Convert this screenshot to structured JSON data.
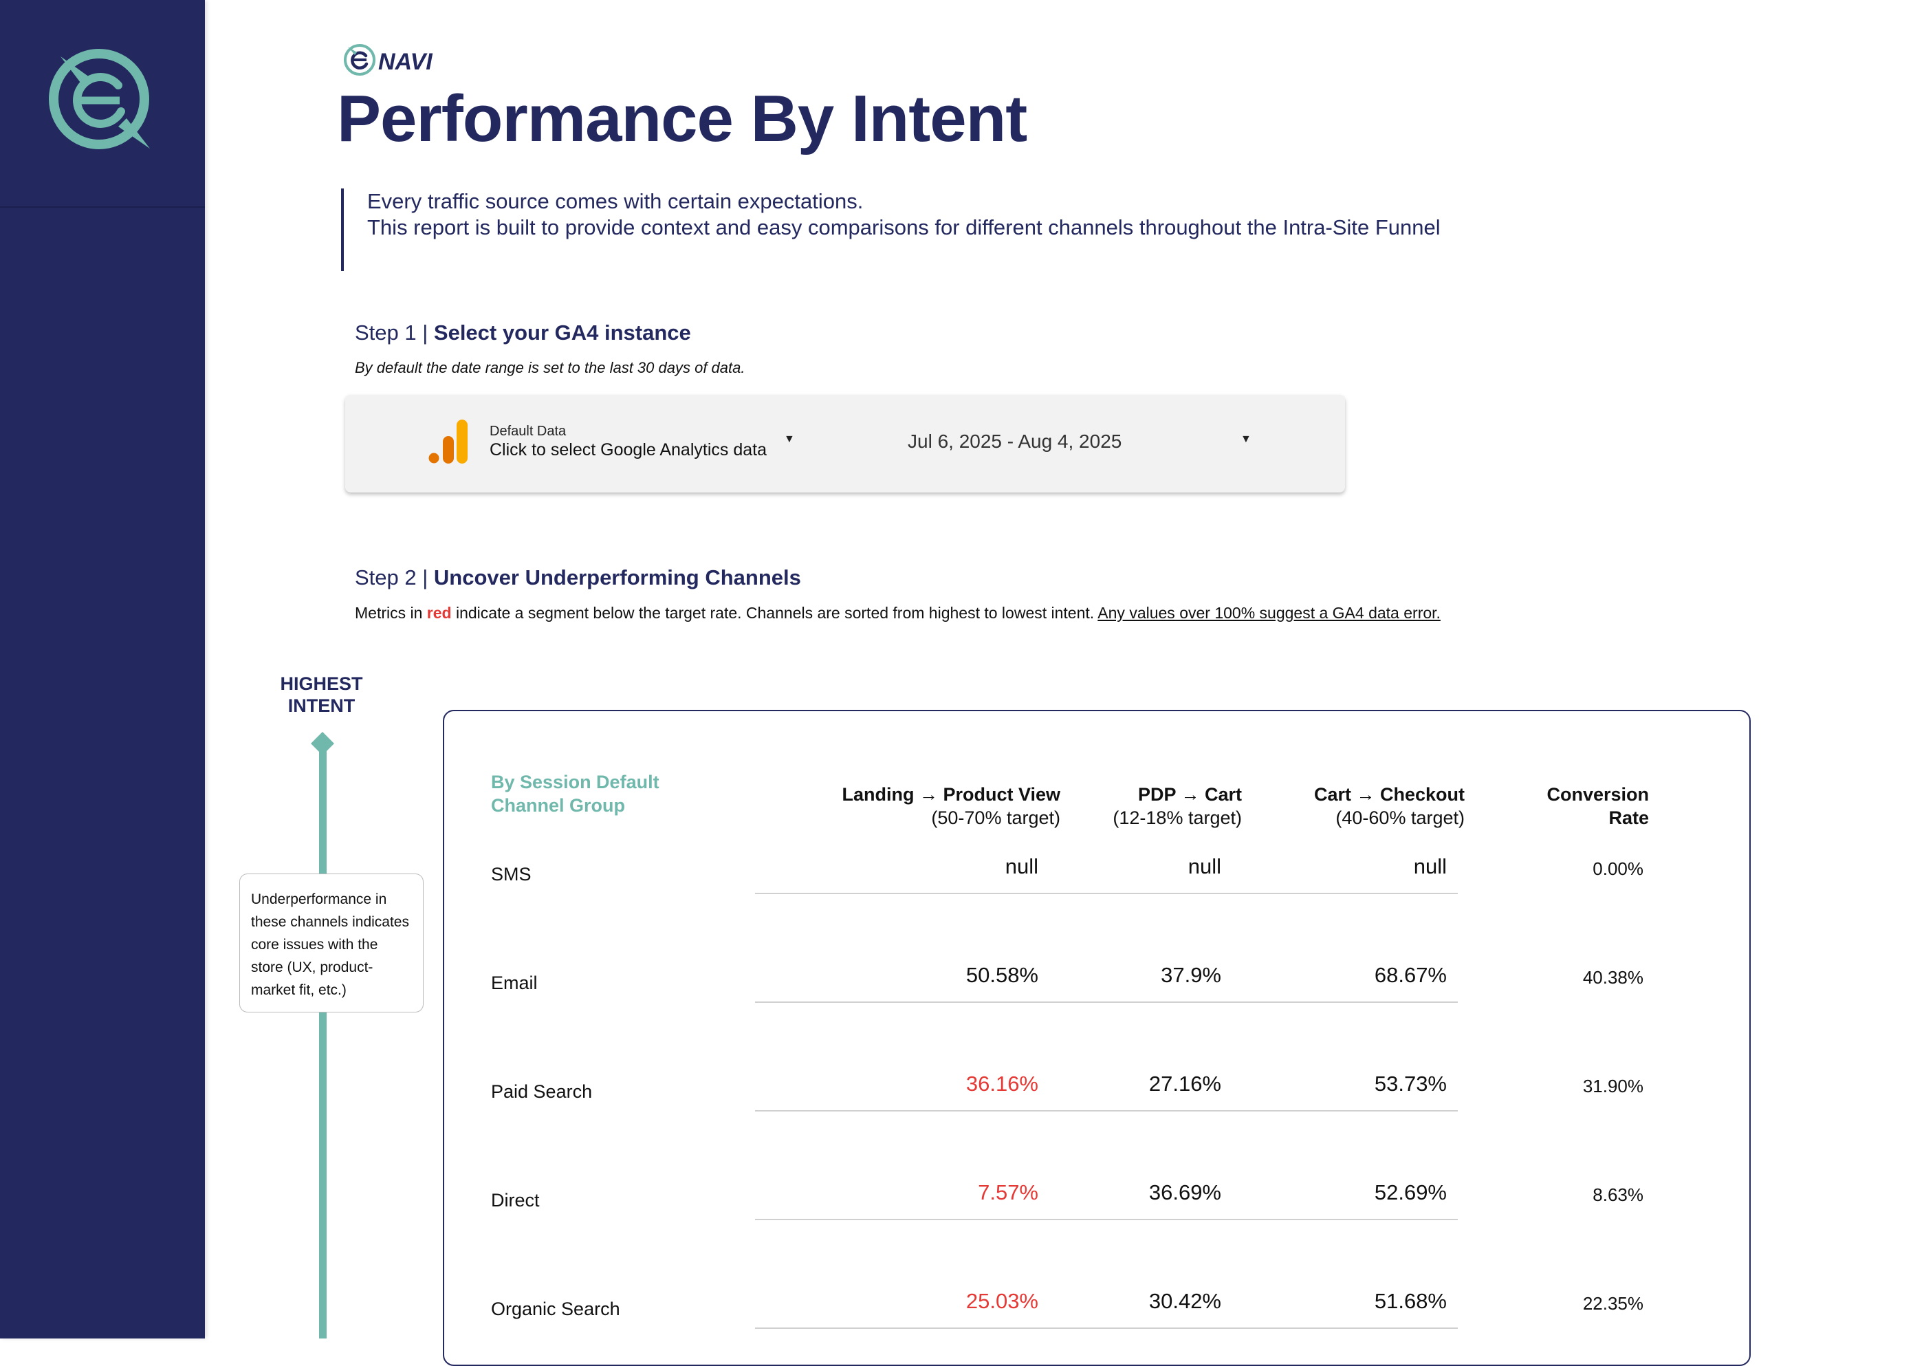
{
  "header": {
    "brand": "NAVI",
    "title": "Performance By Intent",
    "intro": [
      "Every traffic source comes with certain expectations.",
      "This report is built to provide context and easy comparisons for different channels throughout the Intra-Site Funnel"
    ]
  },
  "step1": {
    "prefix": "Step 1 | ",
    "title": "Select your GA4 instance",
    "note": "By default the date range is set to the last 30 days of data."
  },
  "controls": {
    "data_source_label": "Default Data",
    "data_source_value": "Click to select Google Analytics data",
    "date_range": "Jul 6, 2025 - Aug 4, 2025"
  },
  "step2": {
    "prefix": "Step 2 | ",
    "title": "Uncover Underperforming Channels",
    "note_part1": "Metrics in ",
    "note_red": "red",
    "note_part2": " indicate a segment below the target rate. Channels are sorted from highest to lowest intent. ",
    "note_underline": "Any values over 100% suggest a GA4 data error."
  },
  "intent": {
    "label_line1": "HIGHEST",
    "label_line2": "INTENT",
    "callout": "Underperformance in these channels indicates core issues with the store (UX, product-market fit, etc.)"
  },
  "table": {
    "dimension_header_line1": "By Session Default",
    "dimension_header_line2": "Channel Group",
    "columns": [
      {
        "title": "Landing → Product View",
        "target": "(50-70% target)"
      },
      {
        "title": "PDP → Cart",
        "target": "(12-18% target)"
      },
      {
        "title": "Cart → Checkout",
        "target": "(40-60% target)"
      },
      {
        "title": "Conversion",
        "target": "Rate"
      }
    ],
    "rows": [
      {
        "channel": "SMS",
        "lpv": "null",
        "pdp": "null",
        "cart": "null",
        "cr": "0.00%",
        "below": [
          false,
          false,
          false
        ]
      },
      {
        "channel": "Email",
        "lpv": "50.58%",
        "pdp": "37.9%",
        "cart": "68.67%",
        "cr": "40.38%",
        "below": [
          false,
          false,
          false
        ]
      },
      {
        "channel": "Paid Search",
        "lpv": "36.16%",
        "pdp": "27.16%",
        "cart": "53.73%",
        "cr": "31.90%",
        "below": [
          true,
          false,
          false
        ]
      },
      {
        "channel": "Direct",
        "lpv": "7.57%",
        "pdp": "36.69%",
        "cart": "52.69%",
        "cr": "8.63%",
        "below": [
          true,
          false,
          false
        ]
      },
      {
        "channel": "Organic Search",
        "lpv": "25.03%",
        "pdp": "30.42%",
        "cart": "51.68%",
        "cr": "22.35%",
        "below": [
          true,
          false,
          false
        ]
      }
    ]
  },
  "colors": {
    "navy": "#23295f",
    "teal": "#6fb8ab",
    "alert_red": "#e53935",
    "ga_orange_light": "#f9ab00",
    "ga_orange_dark": "#e37400"
  },
  "icons": {
    "sidebar_logo": "e-compass-icon",
    "ga_logo": "google-analytics-icon",
    "dropdown": "caret-down-icon"
  }
}
